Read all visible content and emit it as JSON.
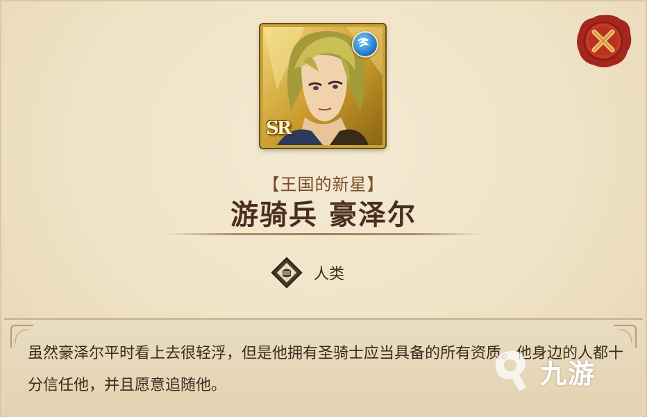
{
  "card": {
    "rarity": "SR",
    "epithet": "【王国的新星】",
    "name": "游骑兵 豪泽尔",
    "race": "人类",
    "description": "虽然豪泽尔平时看上去很轻浮，但是他拥有圣骑士应当具备的所有资质。他身边的人都十分信任他，并且愿意追随他。"
  },
  "icons": {
    "close": "close-icon",
    "element": "wind-element-icon",
    "race": "race-fist-icon"
  },
  "watermark": {
    "text": "九游"
  },
  "colors": {
    "parchment": "#efe3c6",
    "portrait_frame": "#c9a23a",
    "seal_red": "#b32a1f",
    "name_text": "#4a2e1e",
    "epithet_text": "#7a4a2a"
  }
}
